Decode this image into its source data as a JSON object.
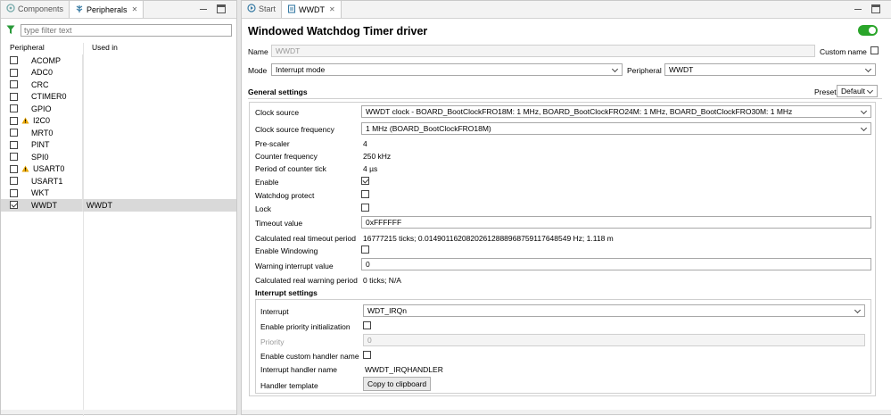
{
  "left_panel": {
    "tabs": [
      {
        "label": "Components",
        "icon": "components-icon",
        "active": false
      },
      {
        "label": "Peripherals",
        "icon": "peripherals-icon",
        "active": true
      }
    ],
    "filter_placeholder": "type filter text",
    "columns": {
      "peripheral": "Peripheral",
      "used_in": "Used in"
    },
    "peripherals": [
      {
        "name": "ACOMP",
        "checked": false,
        "warning": false,
        "used_in": ""
      },
      {
        "name": "ADC0",
        "checked": false,
        "warning": false,
        "used_in": ""
      },
      {
        "name": "CRC",
        "checked": false,
        "warning": false,
        "used_in": ""
      },
      {
        "name": "CTIMER0",
        "checked": false,
        "warning": false,
        "used_in": ""
      },
      {
        "name": "GPIO",
        "checked": false,
        "warning": false,
        "used_in": ""
      },
      {
        "name": "I2C0",
        "checked": false,
        "warning": true,
        "used_in": ""
      },
      {
        "name": "MRT0",
        "checked": false,
        "warning": false,
        "used_in": ""
      },
      {
        "name": "PINT",
        "checked": false,
        "warning": false,
        "used_in": ""
      },
      {
        "name": "SPI0",
        "checked": false,
        "warning": false,
        "used_in": ""
      },
      {
        "name": "USART0",
        "checked": false,
        "warning": true,
        "used_in": ""
      },
      {
        "name": "USART1",
        "checked": false,
        "warning": false,
        "used_in": ""
      },
      {
        "name": "WKT",
        "checked": false,
        "warning": false,
        "used_in": ""
      },
      {
        "name": "WWDT",
        "checked": true,
        "warning": false,
        "used_in": "WWDT",
        "selected": true
      }
    ]
  },
  "right_panel": {
    "tabs": [
      {
        "label": "Start",
        "icon": "start-icon",
        "active": false
      },
      {
        "label": "WWDT",
        "icon": "wwdt-icon",
        "active": true
      }
    ],
    "title": "Windowed Watchdog Timer driver",
    "enabled": true,
    "name_label": "Name",
    "name_value": "WWDT",
    "custom_name_label": "Custom name",
    "mode_label": "Mode",
    "mode_value": "Interrupt mode",
    "peripheral_label": "Peripheral",
    "peripheral_value": "WWDT",
    "general_settings_label": "General settings",
    "preset_label": "Preset",
    "preset_value": "Default",
    "settings": {
      "clock_source_label": "Clock source",
      "clock_source_value": "WWDT clock - BOARD_BootClockFRO18M: 1 MHz, BOARD_BootClockFRO24M: 1 MHz, BOARD_BootClockFRO30M: 1 MHz",
      "clock_freq_label": "Clock source frequency",
      "clock_freq_value": "1 MHz (BOARD_BootClockFRO18M)",
      "prescaler_label": "Pre-scaler",
      "prescaler_value": "4",
      "counter_freq_label": "Counter frequency",
      "counter_freq_value": "250 kHz",
      "period_label": "Period of counter tick",
      "period_value": "4 µs",
      "enable_label": "Enable",
      "enable_checked": true,
      "watchdog_protect_label": "Watchdog protect",
      "lock_label": "Lock",
      "timeout_label": "Timeout value",
      "timeout_value": "0xFFFFFF",
      "calc_timeout_label": "Calculated real timeout period",
      "calc_timeout_value": "16777215 ticks; 0.014901162082026128889687591176485​49 Hz; 1.118 m",
      "windowing_label": "Enable Windowing",
      "warning_label": "Warning interrupt value",
      "warning_value": "0",
      "calc_warning_label": "Calculated real warning period",
      "calc_warning_value": "0 ticks; N/A"
    },
    "interrupt": {
      "section_label": "Interrupt settings",
      "interrupt_label": "Interrupt",
      "interrupt_value": "WDT_IRQn",
      "priority_init_label": "Enable priority initialization",
      "priority_label": "Priority",
      "priority_value": "0",
      "custom_handler_label": "Enable custom handler name",
      "handler_name_label": "Interrupt handler name",
      "handler_name_value": "WWDT_IRQHANDLER",
      "template_label": "Handler template",
      "copy_button": "Copy to clipboard"
    }
  },
  "colors": {
    "accent_green": "#2aa52a",
    "selection": "#d9d9d9",
    "warning": "#e8a600"
  }
}
